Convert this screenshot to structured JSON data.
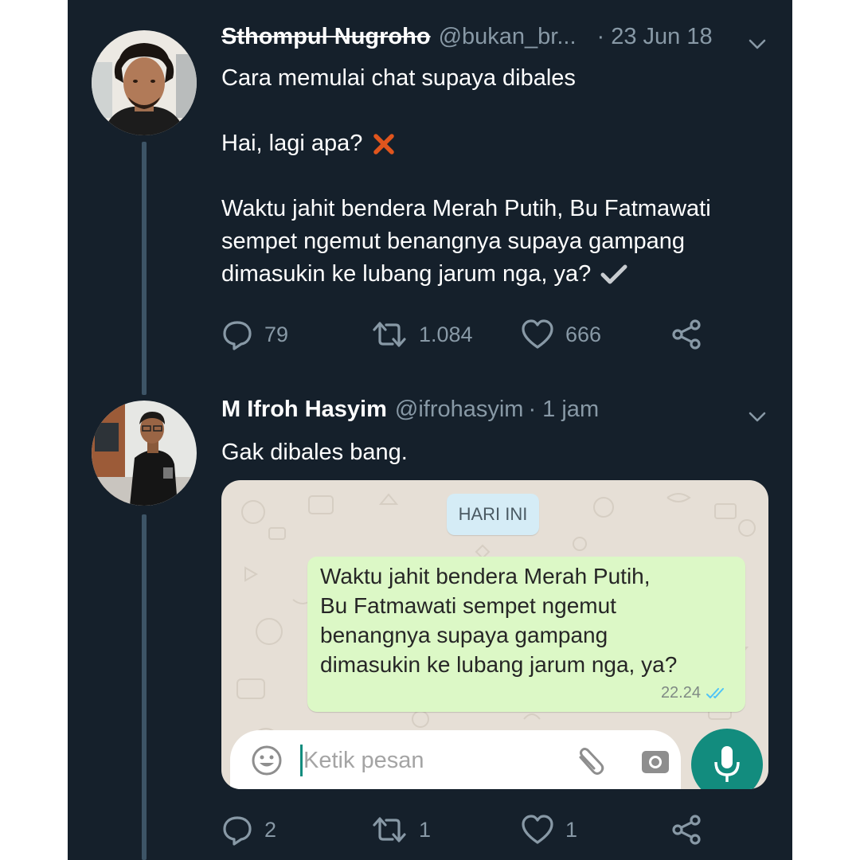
{
  "tweet1": {
    "name": "Sthompul Nugroho",
    "handle": "@bukan_br...",
    "date": "· 23 Jun 18",
    "lines": [
      "Cara memulai chat supaya dibales",
      "Hai, lagi apa?",
      "Waktu jahit bendera Merah Putih, Bu Fatmawati",
      "sempet ngemut benangnya supaya gampang",
      "dimasukin ke lubang jarum nga, ya?"
    ],
    "replies": "79",
    "retweets": "1.084",
    "likes": "666"
  },
  "tweet2": {
    "name": "M Ifroh Hasyim",
    "handle": "@ifrohasyim",
    "time": "· 1 jam",
    "text": "Gak dibales bang.",
    "replies": "2",
    "retweets": "1",
    "likes": "1"
  },
  "whatsapp": {
    "date_chip": "HARI INI",
    "message_lines": [
      "Waktu jahit bendera Merah Putih,",
      "Bu Fatmawati sempet ngemut",
      "benangnya supaya gampang",
      "dimasukin ke lubang jarum nga, ya?"
    ],
    "message_time": "22.24",
    "input_placeholder": "Ketik pesan"
  },
  "colors": {
    "background": "#15202b",
    "text": "#ffffff",
    "muted": "#8899a6",
    "wrong_mark": "#e0551d",
    "wa_bubble": "#dcf8c6",
    "wa_accent": "#128c7e",
    "read_ticks": "#4fc3f7"
  },
  "icons": [
    "chevron-down-icon",
    "cross-mark-icon",
    "check-mark-icon",
    "reply-icon",
    "retweet-icon",
    "like-icon",
    "share-icon",
    "emoji-icon",
    "attach-icon",
    "camera-icon",
    "mic-icon",
    "double-check-icon"
  ]
}
